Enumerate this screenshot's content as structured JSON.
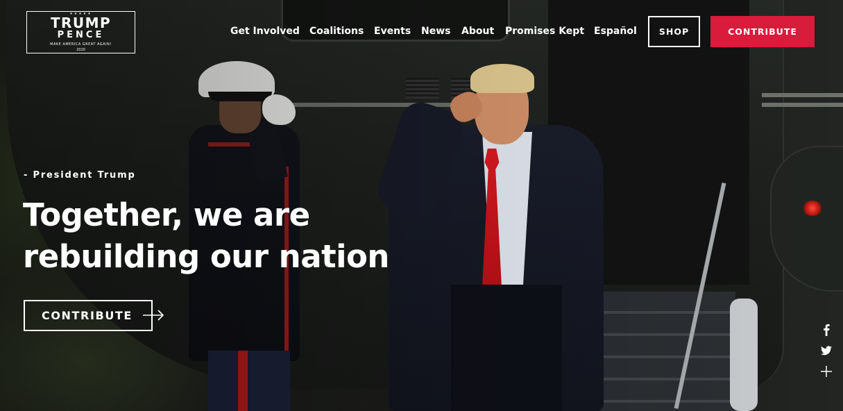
{
  "logo": {
    "stars": "★★★★★",
    "line1": "TRUMP",
    "line2": "PENCE",
    "slogan": "MAKE AMERICA GREAT AGAIN!",
    "year": "2020"
  },
  "nav": {
    "items": [
      {
        "label": "Get Involved"
      },
      {
        "label": "Coalitions"
      },
      {
        "label": "Events"
      },
      {
        "label": "News"
      },
      {
        "label": "About"
      },
      {
        "label": "Promises Kept"
      },
      {
        "label": "Español"
      }
    ],
    "shop_label": "SHOP",
    "contribute_label": "CONTRIBUTE"
  },
  "hero": {
    "attribution": "- President Trump",
    "headline_line1": "Together, we are",
    "headline_line2": "rebuilding our nation",
    "cta_label": "CONTRIBUTE"
  },
  "social": {
    "icons": [
      "facebook-icon",
      "twitter-icon",
      "plus-icon"
    ]
  },
  "colors": {
    "accent": "#d91c3b",
    "text": "#ffffff"
  }
}
